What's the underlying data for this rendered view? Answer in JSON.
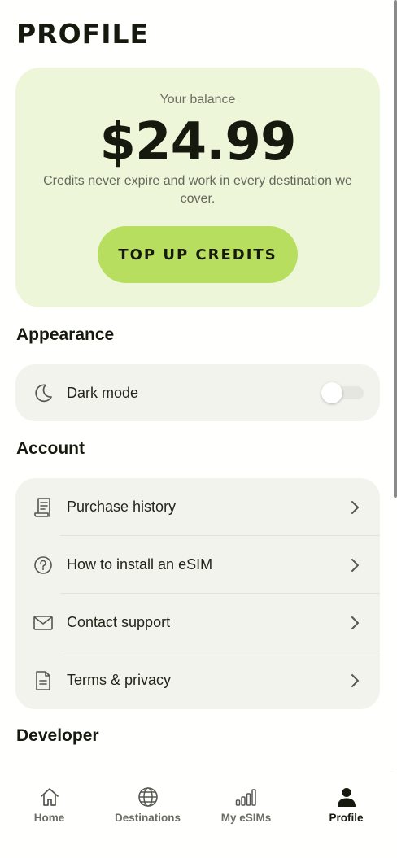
{
  "page": {
    "title": "PROFILE"
  },
  "balance": {
    "label": "Your balance",
    "amount": "$24.99",
    "note": "Credits never expire and work in every destination we cover.",
    "button": "TOP UP CREDITS"
  },
  "appearance": {
    "title": "Appearance",
    "dark_mode": {
      "label": "Dark mode",
      "enabled": false,
      "icon": "moon-icon"
    }
  },
  "account": {
    "title": "Account",
    "items": [
      {
        "label": "Purchase history",
        "icon": "receipt-icon"
      },
      {
        "label": "How to install an eSIM",
        "icon": "question-circle-icon"
      },
      {
        "label": "Contact support",
        "icon": "envelope-icon"
      },
      {
        "label": "Terms & privacy",
        "icon": "document-icon"
      }
    ]
  },
  "developer": {
    "title": "Developer"
  },
  "tabbar": {
    "tabs": [
      {
        "label": "Home",
        "icon": "home-icon",
        "active": false
      },
      {
        "label": "Destinations",
        "icon": "globe-icon",
        "active": false
      },
      {
        "label": "My eSIMs",
        "icon": "signal-bars-icon",
        "active": false
      },
      {
        "label": "Profile",
        "icon": "person-icon",
        "active": true
      }
    ]
  },
  "colors": {
    "accent": "#b8de60",
    "card_bg": "#edf6d8",
    "group_bg": "#f3f3ee",
    "text_dark": "#161a0e"
  }
}
